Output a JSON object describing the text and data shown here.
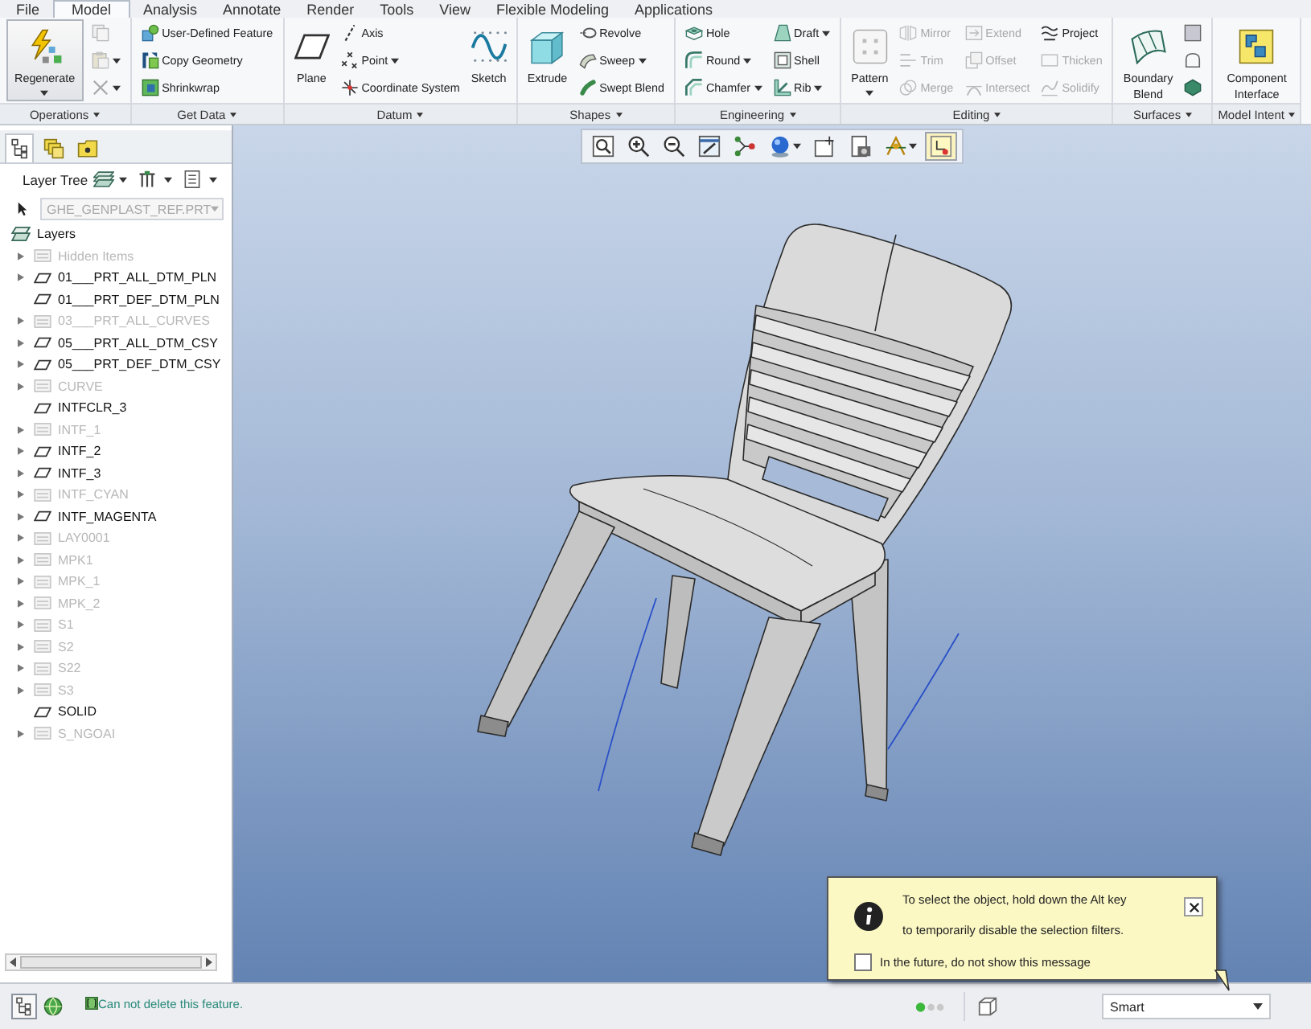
{
  "ribbon": {
    "tabs": [
      {
        "label": "File",
        "selected": false
      },
      {
        "label": "Model",
        "selected": true
      },
      {
        "label": "Analysis",
        "selected": false
      },
      {
        "label": "Annotate",
        "selected": false
      },
      {
        "label": "Render",
        "selected": false
      },
      {
        "label": "Tools",
        "selected": false
      },
      {
        "label": "View",
        "selected": false
      },
      {
        "label": "Flexible Modeling",
        "selected": false
      },
      {
        "label": "Applications",
        "selected": false
      }
    ],
    "groups": [
      {
        "label": "Operations",
        "columns": [
          [
            {
              "kind": "large",
              "label": "Regenerate",
              "dropdown": true,
              "disabled": false,
              "pressed": true
            }
          ],
          [
            {
              "kind": "small",
              "dropdown": false,
              "disabled": true,
              "pressed": false
            },
            {
              "kind": "small",
              "dropdown": true,
              "disabled": true,
              "pressed": false
            },
            {
              "kind": "small",
              "dropdown": true,
              "disabled": true,
              "pressed": false
            }
          ]
        ]
      },
      {
        "label": "Get Data",
        "columns": [
          [
            {
              "kind": "small",
              "label": "User-Defined Feature",
              "dropdown": false,
              "disabled": false,
              "pressed": false
            },
            {
              "kind": "small",
              "label": "Copy Geometry",
              "dropdown": false,
              "disabled": false,
              "pressed": false
            },
            {
              "kind": "small",
              "label": "Shrinkwrap",
              "dropdown": false,
              "disabled": false,
              "pressed": false
            }
          ]
        ]
      },
      {
        "label": "Datum",
        "columns": [
          [
            {
              "kind": "large",
              "label": "Plane",
              "dropdown": false,
              "disabled": false,
              "pressed": false
            }
          ],
          [
            {
              "kind": "small",
              "label": "Axis",
              "dropdown": false,
              "disabled": false,
              "pressed": false
            },
            {
              "kind": "small",
              "label": "Point",
              "dropdown": true,
              "disabled": false,
              "pressed": false
            },
            {
              "kind": "small",
              "label": "Coordinate System",
              "dropdown": false,
              "disabled": false,
              "pressed": false
            }
          ],
          [
            {
              "kind": "large",
              "label": "Sketch",
              "dropdown": false,
              "disabled": false,
              "pressed": false
            }
          ]
        ]
      },
      {
        "label": "Shapes",
        "columns": [
          [
            {
              "kind": "large",
              "label": "Extrude",
              "dropdown": false,
              "disabled": false,
              "pressed": false
            }
          ],
          [
            {
              "kind": "small",
              "label": "Revolve",
              "dropdown": false,
              "disabled": false,
              "pressed": false
            },
            {
              "kind": "small",
              "label": "Sweep",
              "dropdown": true,
              "disabled": false,
              "pressed": false
            },
            {
              "kind": "small",
              "label": "Swept Blend",
              "dropdown": false,
              "disabled": false,
              "pressed": false
            }
          ]
        ]
      },
      {
        "label": "Engineering",
        "columns": [
          [
            {
              "kind": "small",
              "label": "Hole",
              "dropdown": false,
              "disabled": false,
              "pressed": false
            },
            {
              "kind": "small",
              "label": "Round",
              "dropdown": true,
              "disabled": false,
              "pressed": false
            },
            {
              "kind": "small",
              "label": "Chamfer",
              "dropdown": true,
              "disabled": false,
              "pressed": false
            }
          ],
          [
            {
              "kind": "small",
              "label": "Draft",
              "dropdown": true,
              "disabled": false,
              "pressed": false
            },
            {
              "kind": "small",
              "label": "Shell",
              "dropdown": false,
              "disabled": false,
              "pressed": false
            },
            {
              "kind": "small",
              "label": "Rib",
              "dropdown": true,
              "disabled": false,
              "pressed": false
            }
          ]
        ]
      },
      {
        "label": "Editing",
        "columns": [
          [
            {
              "kind": "large",
              "label": "Pattern",
              "dropdown": true,
              "disabled": false,
              "pressed": false
            }
          ],
          [
            {
              "kind": "small",
              "label": "Mirror",
              "dropdown": false,
              "disabled": true,
              "pressed": false
            },
            {
              "kind": "small",
              "label": "Trim",
              "dropdown": false,
              "disabled": true,
              "pressed": false
            },
            {
              "kind": "small",
              "label": "Merge",
              "dropdown": false,
              "disabled": true,
              "pressed": false
            }
          ],
          [
            {
              "kind": "small",
              "label": "Extend",
              "dropdown": false,
              "disabled": true,
              "pressed": false
            },
            {
              "kind": "small",
              "label": "Offset",
              "dropdown": false,
              "disabled": true,
              "pressed": false
            },
            {
              "kind": "small",
              "label": "Intersect",
              "dropdown": false,
              "disabled": true,
              "pressed": false
            }
          ],
          [
            {
              "kind": "small",
              "label": "Project",
              "dropdown": false,
              "disabled": false,
              "pressed": false
            },
            {
              "kind": "small",
              "label": "Thicken",
              "dropdown": false,
              "disabled": true,
              "pressed": false
            },
            {
              "kind": "small",
              "label": "Solidify",
              "dropdown": false,
              "disabled": true,
              "pressed": false
            }
          ]
        ]
      },
      {
        "label": "Surfaces",
        "columns": [
          [
            {
              "kind": "large",
              "label": "Boundary Blend",
              "dropdown": false,
              "disabled": false,
              "pressed": false
            }
          ],
          [
            {
              "kind": "small",
              "dropdown": false,
              "disabled": false,
              "pressed": false
            },
            {
              "kind": "small",
              "dropdown": false,
              "disabled": false,
              "pressed": false
            },
            {
              "kind": "small",
              "dropdown": false,
              "disabled": false,
              "pressed": false
            }
          ]
        ]
      },
      {
        "label": "Model Intent",
        "columns": [
          [
            {
              "kind": "large",
              "label": "Component Interface",
              "dropdown": false,
              "disabled": false,
              "pressed": false
            }
          ]
        ]
      }
    ]
  },
  "view_toolbar": [
    {
      "dropdown": false,
      "selected": false
    },
    {
      "dropdown": false,
      "selected": false
    },
    {
      "dropdown": false,
      "selected": false
    },
    {
      "dropdown": false,
      "selected": false
    },
    {
      "dropdown": false,
      "selected": false
    },
    {
      "dropdown": true,
      "selected": false
    },
    {
      "dropdown": false,
      "selected": false
    },
    {
      "dropdown": false,
      "selected": false
    },
    {
      "dropdown": true,
      "selected": false
    },
    {
      "dropdown": false,
      "selected": true
    }
  ],
  "left_panel": {
    "tabs": [
      {
        "selected": true
      },
      {
        "selected": false
      },
      {
        "selected": false
      }
    ],
    "header": {
      "label": "Layer Tree"
    },
    "model_select": {
      "value": "GHE_GENPLAST_REF.PRT",
      "disabled": true
    },
    "tree": {
      "label": "Layers",
      "children": [
        {
          "label": "Hidden Items",
          "disabled": true,
          "expandable": true
        },
        {
          "label": "01___PRT_ALL_DTM_PLN",
          "disabled": false,
          "expandable": true
        },
        {
          "label": "01___PRT_DEF_DTM_PLN",
          "disabled": false,
          "expandable": false
        },
        {
          "label": "03___PRT_ALL_CURVES",
          "disabled": true,
          "expandable": true
        },
        {
          "label": "05___PRT_ALL_DTM_CSY",
          "disabled": false,
          "expandable": true
        },
        {
          "label": "05___PRT_DEF_DTM_CSY",
          "disabled": false,
          "expandable": true
        },
        {
          "label": "CURVE",
          "disabled": true,
          "expandable": true
        },
        {
          "label": "INTFCLR_3",
          "disabled": false,
          "expandable": false
        },
        {
          "label": "INTF_1",
          "disabled": true,
          "expandable": true
        },
        {
          "label": "INTF_2",
          "disabled": false,
          "expandable": true
        },
        {
          "label": "INTF_3",
          "disabled": false,
          "expandable": true
        },
        {
          "label": "INTF_CYAN",
          "disabled": true,
          "expandable": true
        },
        {
          "label": "INTF_MAGENTA",
          "disabled": false,
          "expandable": true
        },
        {
          "label": "LAY0001",
          "disabled": true,
          "expandable": true
        },
        {
          "label": "MPK1",
          "disabled": true,
          "expandable": true
        },
        {
          "label": "MPK_1",
          "disabled": true,
          "expandable": true
        },
        {
          "label": "MPK_2",
          "disabled": true,
          "expandable": true
        },
        {
          "label": "S1",
          "disabled": true,
          "expandable": true
        },
        {
          "label": "S2",
          "disabled": true,
          "expandable": true
        },
        {
          "label": "S22",
          "disabled": true,
          "expandable": true
        },
        {
          "label": "S3",
          "disabled": true,
          "expandable": true
        },
        {
          "label": "SOLID",
          "disabled": false,
          "expandable": false
        },
        {
          "label": "S_NGOAI",
          "disabled": true,
          "expandable": true
        }
      ]
    }
  },
  "popup": {
    "message": "To select the object, hold down the Alt key\nto temporarily disable the selection filters.",
    "checkbox": {
      "label": "In the future, do not show this message",
      "checked": false
    }
  },
  "status_bar": {
    "toggles": [
      {
        "selected": true
      },
      {
        "selected": false
      }
    ],
    "message": "Can not delete this feature.",
    "selection_filter": {
      "value": "Smart"
    }
  }
}
